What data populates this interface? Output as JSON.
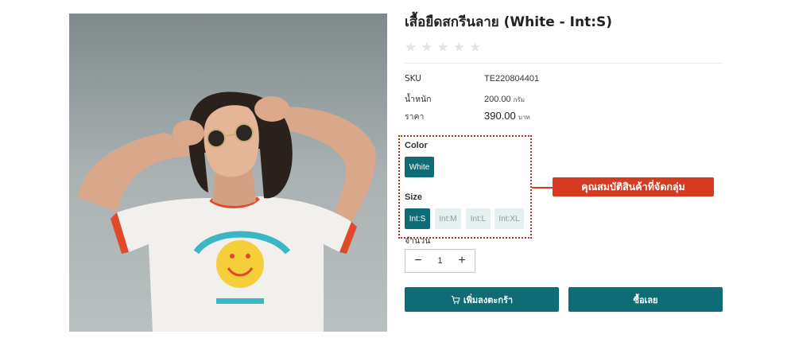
{
  "product": {
    "title": "เสื้อยืดสกรีนลาย (White - Int:S)",
    "rating_stars": 5,
    "rating_value": 0
  },
  "specs": {
    "sku_label": "SKU",
    "sku_value": "TE220804401",
    "weight_label": "น้ำหนัก",
    "weight_value": "200.00",
    "weight_unit": "กรัม",
    "price_label": "ราคา",
    "price_value": "390.00",
    "price_unit": "บาท"
  },
  "options": {
    "color_label": "Color",
    "colors": [
      {
        "label": "White",
        "selected": true
      }
    ],
    "size_label": "Size",
    "sizes": [
      {
        "label": "Int:S",
        "selected": true
      },
      {
        "label": "Int:M",
        "selected": false
      },
      {
        "label": "Int:L",
        "selected": false
      },
      {
        "label": "Int:XL",
        "selected": false
      }
    ]
  },
  "quantity": {
    "label": "จำนวน",
    "value": "1",
    "minus": "−",
    "plus": "+"
  },
  "actions": {
    "add_to_cart": "เพิ่มลงตะกร้า",
    "buy_now": "ซื้อเลย"
  },
  "annotation": {
    "callout_text": "คุณสมบัติสินค้าที่จัดกลุ่ม"
  },
  "colors": {
    "accent": "#0f6c76",
    "chip_inactive_bg": "#e5f0f1",
    "callout": "#d63a1f",
    "star_empty": "#e2e4e5"
  }
}
